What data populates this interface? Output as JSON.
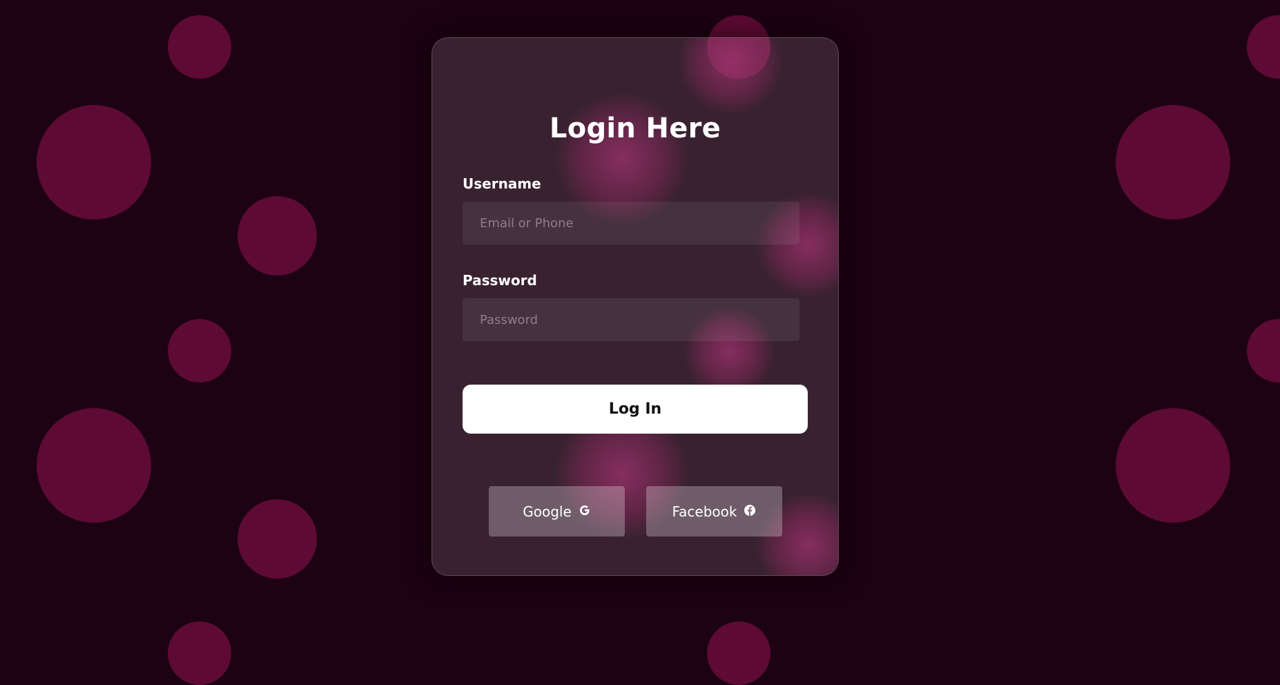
{
  "login": {
    "title": "Login Here",
    "username": {
      "label": "Username",
      "placeholder": "Email or Phone",
      "value": ""
    },
    "password": {
      "label": "Password",
      "placeholder": "Password",
      "value": ""
    },
    "submit_label": "Log In",
    "social": [
      {
        "label": "Google",
        "icon": "google-icon"
      },
      {
        "label": "Facebook",
        "icon": "facebook-icon"
      }
    ]
  },
  "colors": {
    "background": "#1c0212",
    "decorative_circle": "#5d0a34",
    "card_glass": "rgba(255,255,255,0.13)",
    "button_primary": "#ffffff",
    "button_social": "rgba(255,255,255,0.27)"
  }
}
